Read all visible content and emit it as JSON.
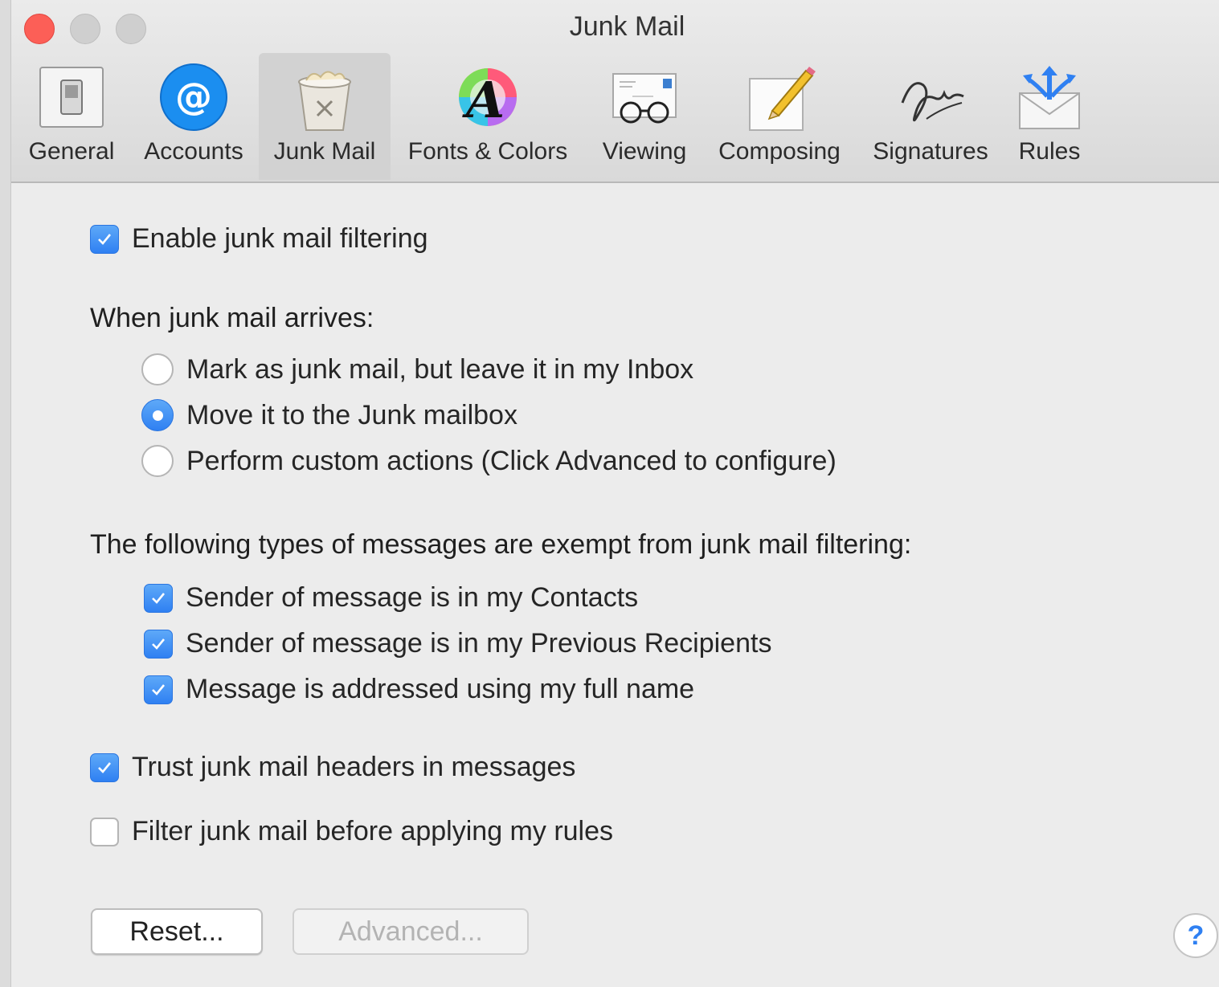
{
  "window": {
    "title": "Junk Mail"
  },
  "toolbar": {
    "tabs": [
      {
        "label": "General",
        "icon": "switch-icon"
      },
      {
        "label": "Accounts",
        "icon": "at-sign-icon"
      },
      {
        "label": "Junk Mail",
        "icon": "trash-can-icon",
        "selected": true
      },
      {
        "label": "Fonts & Colors",
        "icon": "font-color-wheel-icon"
      },
      {
        "label": "Viewing",
        "icon": "glasses-letter-icon"
      },
      {
        "label": "Composing",
        "icon": "paper-pencil-icon"
      },
      {
        "label": "Signatures",
        "icon": "signature-icon"
      },
      {
        "label": "Rules",
        "icon": "envelope-arrows-icon"
      }
    ]
  },
  "settings": {
    "enable_filtering": {
      "label": "Enable junk mail filtering",
      "checked": true
    },
    "arrival_heading": "When junk mail arrives:",
    "arrival_options": [
      {
        "label": "Mark as junk mail, but leave it in my Inbox",
        "selected": false
      },
      {
        "label": "Move it to the Junk mailbox",
        "selected": true
      },
      {
        "label": "Perform custom actions (Click Advanced to configure)",
        "selected": false
      }
    ],
    "exempt_heading": "The following types of messages are exempt from junk mail filtering:",
    "exempt_options": [
      {
        "label": "Sender of message is in my Contacts",
        "checked": true
      },
      {
        "label": "Sender of message is in my Previous Recipients",
        "checked": true
      },
      {
        "label": "Message is addressed using my full name",
        "checked": true
      }
    ],
    "trust_headers": {
      "label": "Trust junk mail headers in messages",
      "checked": true
    },
    "filter_before_rules": {
      "label": "Filter junk mail before applying my rules",
      "checked": false
    }
  },
  "buttons": {
    "reset": "Reset...",
    "advanced": "Advanced...",
    "help": "?"
  },
  "colors": {
    "accent": "#2f80f2",
    "close": "#fc5f57"
  }
}
